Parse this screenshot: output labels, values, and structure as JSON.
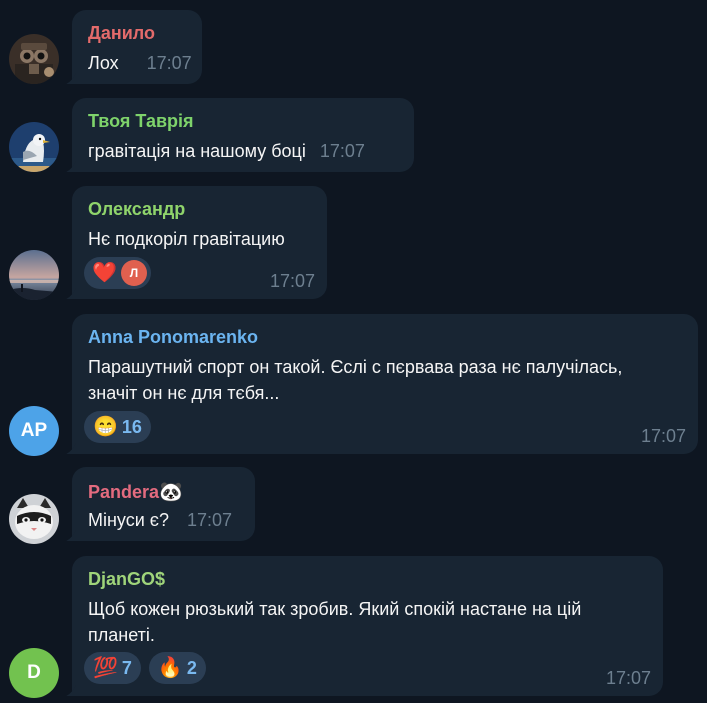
{
  "colors": {
    "background": "#0e1621",
    "bubble": "#182533",
    "timestamp": "#6d7f8f",
    "reaction_bg": "#2b3e54",
    "reaction_count": "#7ab9f0"
  },
  "messages": [
    {
      "sender": "Данило",
      "sender_color": "#e36b6b",
      "avatar": {
        "type": "image",
        "icon": "owl-robot-avatar"
      },
      "lines": [
        "Лох"
      ],
      "time": "17:07"
    },
    {
      "sender": "Твоя Таврія",
      "sender_color": "#7ed36b",
      "avatar": {
        "type": "image",
        "icon": "seagull-avatar"
      },
      "lines": [
        "гравітація на нашому боці"
      ],
      "time": "17:07"
    },
    {
      "sender": "Олександр",
      "sender_color": "#8fd46b",
      "avatar": {
        "type": "image",
        "icon": "sunset-lake-avatar"
      },
      "lines": [
        "Нє подкоріл гравітацию"
      ],
      "time": "17:07",
      "reactions": [
        {
          "emoji": "❤️",
          "icon": "heart-icon",
          "reactor_initial": "Л"
        }
      ]
    },
    {
      "sender": "Anna Ponomarenko",
      "sender_color": "#6bb4f0",
      "avatar": {
        "type": "initials",
        "initials": "AP",
        "color": "#4da3e8"
      },
      "lines": [
        "Парашутний спорт он такой. Єслі с пєрвава раза нє палучілась,",
        "значіт он нє для тєбя..."
      ],
      "time": "17:07",
      "reactions": [
        {
          "emoji": "😁",
          "icon": "grin-icon",
          "count": "16"
        }
      ]
    },
    {
      "sender": "Pandera",
      "sender_emoji": "🐼",
      "sender_color": "#e36b7f",
      "avatar": {
        "type": "image",
        "icon": "cat-mask-avatar"
      },
      "lines": [
        "Мінуси є?"
      ],
      "time": "17:07"
    },
    {
      "sender": "DjanGO$",
      "sender_color": "#9fd47a",
      "avatar": {
        "type": "initials",
        "initials": "D",
        "color": "#72c24f"
      },
      "lines": [
        "Щоб кожен рюзький так зробив. Який спокій настане на цій",
        "планеті."
      ],
      "time": "17:07",
      "reactions": [
        {
          "emoji": "💯",
          "icon": "hundred-icon",
          "count": "7"
        },
        {
          "emoji": "🔥",
          "icon": "fire-icon",
          "count": "2"
        }
      ]
    }
  ]
}
